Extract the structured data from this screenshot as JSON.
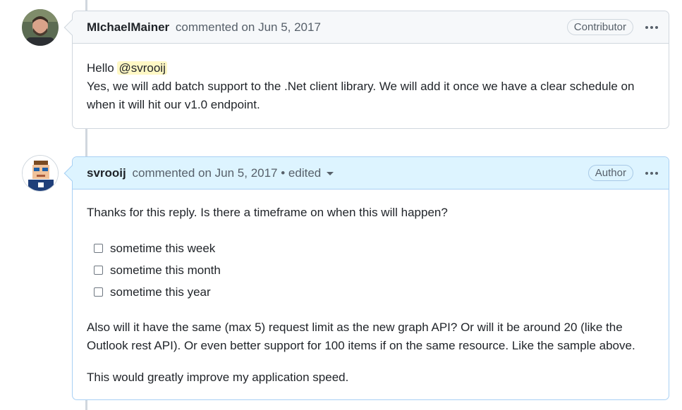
{
  "comments": [
    {
      "author": "MIchaelMainer",
      "action": "commented on Jun 5, 2017",
      "badge": "Contributor",
      "greeting": "Hello",
      "mention": "@svrooij",
      "body": "Yes, we will add batch support to the .Net client library. We will add it once we have a clear schedule on when it will hit our v1.0 endpoint."
    },
    {
      "author": "svrooij",
      "action": "commented on Jun 5, 2017",
      "edited": "• edited",
      "badge": "Author",
      "intro": "Thanks for this reply. Is there a timeframe on when this will happen?",
      "tasks": [
        "sometime this week",
        "sometime this month",
        "sometime this year"
      ],
      "paragraph": "Also will it have the same (max 5) request limit as the new graph API? Or will it be around 20 (like the Outlook rest API). Or even better support for 100 items if on the same resource. Like the sample above.",
      "closing": "This would greatly improve my application speed."
    }
  ],
  "colors": {
    "author_header": "#ddf4ff",
    "header": "#f6f8fa",
    "mention_bg": "#fff8c5"
  },
  "icons": [
    "avatar-michaelmainer",
    "avatar-svrooij",
    "kebab-icon",
    "caret-down-icon",
    "checkbox-icon"
  ]
}
